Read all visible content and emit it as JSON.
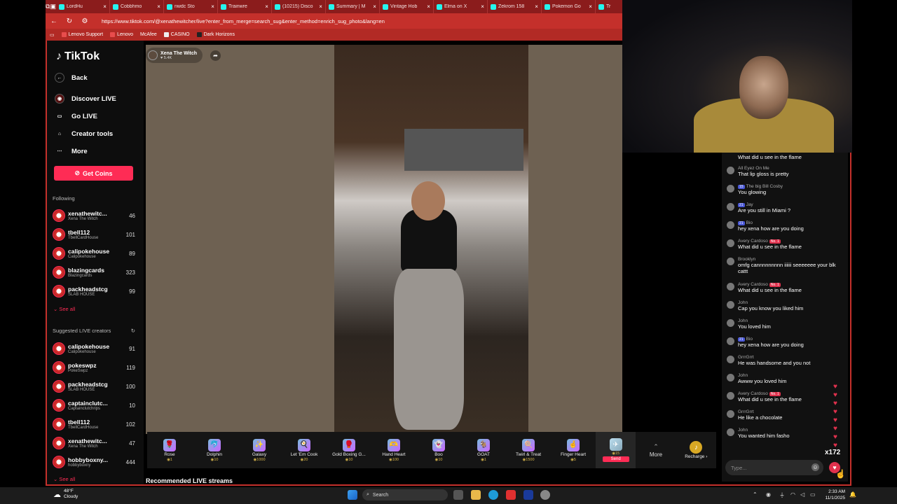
{
  "browser": {
    "tabs": [
      "LordHu",
      "Cobbhmo",
      "nwdc Sto",
      "Trainwre",
      "(10215) Disco",
      "Summary | M",
      "Vintage Hob",
      "Elma on X",
      "Zekrom 158",
      "Pokemon Go",
      "Tr"
    ],
    "url": "https://www.tiktok.com/@xenathewitcher/live?enter_from_merge=search_sug&enter_method=enrich_sug_photo&lang=en",
    "bookmarks": [
      "Lenovo Support",
      "Lenovo",
      "McAfee",
      "CASINO",
      "Dark Horizons"
    ]
  },
  "sidebar": {
    "logo": "TikTok",
    "back": "Back",
    "nav": [
      {
        "label": "Discover LIVE",
        "icon": "discover-live-icon"
      },
      {
        "label": "Go LIVE",
        "icon": "camera-icon"
      },
      {
        "label": "Creator tools",
        "icon": "lightbulb-icon"
      },
      {
        "label": "More",
        "icon": "ellipsis-icon"
      }
    ],
    "get_coins": "Get Coins",
    "following_title": "Following",
    "following": [
      {
        "user": "xenathewitc...",
        "display": "Xena The Witch",
        "count": "46"
      },
      {
        "user": "tbell112",
        "display": "TbellCardHouse",
        "count": "101"
      },
      {
        "user": "calipokehouse",
        "display": "Calipokehouse",
        "count": "89"
      },
      {
        "user": "blazingcards",
        "display": "Blazingcards",
        "count": "323"
      },
      {
        "user": "packheadstcg",
        "display": "SLAB HOUSE",
        "count": "99"
      }
    ],
    "see_all": "See all",
    "suggested_title": "Suggested LIVE creators",
    "suggested": [
      {
        "user": "calipokehouse",
        "display": "Calipokehouse",
        "count": "91"
      },
      {
        "user": "pokeswpz",
        "display": "PokeSwpz",
        "count": "119"
      },
      {
        "user": "packheadstcg",
        "display": "SLAB HOUSE",
        "count": "100"
      },
      {
        "user": "captainclutc...",
        "display": "Captainclutchrips",
        "count": "10"
      },
      {
        "user": "tbell112",
        "display": "TbellCardHouse",
        "count": "102"
      },
      {
        "user": "xenathewitc...",
        "display": "Xena The Witch",
        "count": "47"
      },
      {
        "user": "hobbyboxny...",
        "display": "hobbyboxny",
        "count": "444"
      }
    ],
    "see_all_2": "See all"
  },
  "stream": {
    "name": "Xena The Witch",
    "likes": "5.4K"
  },
  "gifts": [
    {
      "name": "Rose",
      "price": "1",
      "icon": "🌹"
    },
    {
      "name": "Dolphin",
      "price": "10",
      "icon": "🐬"
    },
    {
      "name": "Galaxy",
      "price": "1000",
      "icon": "✨"
    },
    {
      "name": "Let 'Em Cook",
      "price": "20",
      "icon": "🍳"
    },
    {
      "name": "Gold Boxing G...",
      "price": "10",
      "icon": "🥊"
    },
    {
      "name": "Hand Heart",
      "price": "100",
      "icon": "🫶"
    },
    {
      "name": "Boo",
      "price": "10",
      "icon": "👻"
    },
    {
      "name": "GOAT",
      "price": "1",
      "icon": "🐐"
    },
    {
      "name": "Twirl & Treat",
      "price": "1500",
      "icon": "🍭"
    },
    {
      "name": "Finger Heart",
      "price": "5",
      "icon": "🤞"
    }
  ],
  "send_gift": {
    "price": "15",
    "label": "Send"
  },
  "more_label": "More",
  "recharge_label": "Recharge",
  "recommended_title": "Recommended LIVE streams",
  "chat": [
    {
      "user": "",
      "badge": "",
      "rank": "",
      "text": "What did u see in the flame"
    },
    {
      "user": "All Eyez On Me",
      "badge": "",
      "rank": "",
      "text": "That lip gloss is pretty"
    },
    {
      "user": "The big Bill Cosby",
      "badge": "15",
      "rank": "",
      "text": "You glowing"
    },
    {
      "user": "Jay",
      "badge": "21",
      "rank": "",
      "text": "Are you still in Miami ?"
    },
    {
      "user": "Bio",
      "badge": "21",
      "rank": "",
      "text": "hey xena how are you doing"
    },
    {
      "user": "Avery Cardoso",
      "badge": "",
      "rank": "No. 1",
      "text": "What did u see in the flame"
    },
    {
      "user": "Brooklyn",
      "badge": "",
      "rank": "",
      "text": "omfg cannnnnnnnn iiiiii seeeeeee your blk cattt"
    },
    {
      "user": "Avery Cardoso",
      "badge": "",
      "rank": "No. 1",
      "text": "What did u see in the flame"
    },
    {
      "user": "John",
      "badge": "",
      "rank": "",
      "text": "Cap you know you liked him"
    },
    {
      "user": "John",
      "badge": "",
      "rank": "",
      "text": "You loved him"
    },
    {
      "user": "Bio",
      "badge": "21",
      "rank": "",
      "text": "hey xena how are you doing"
    },
    {
      "user": "GrrrGrrt",
      "badge": "",
      "rank": "",
      "text": "He was handsome and you not"
    },
    {
      "user": "John",
      "badge": "",
      "rank": "",
      "text": "Awww you loved him"
    },
    {
      "user": "Avery Cardoso",
      "badge": "",
      "rank": "No. 1",
      "text": "What did u see in the flame"
    },
    {
      "user": "GrrrGrrt",
      "badge": "",
      "rank": "",
      "text": "He like a chocolate"
    },
    {
      "user": "John",
      "badge": "",
      "rank": "",
      "text": "You wanted him fasho"
    }
  ],
  "combo": "x172",
  "chat_placeholder": "Type...",
  "taskbar": {
    "temp": "48°F",
    "weather": "Cloudy",
    "search": "Search",
    "time": "2:33 AM",
    "date": "11/1/2025"
  },
  "colors": {
    "accent": "#fe2c55",
    "chrome": "#c4302b"
  }
}
